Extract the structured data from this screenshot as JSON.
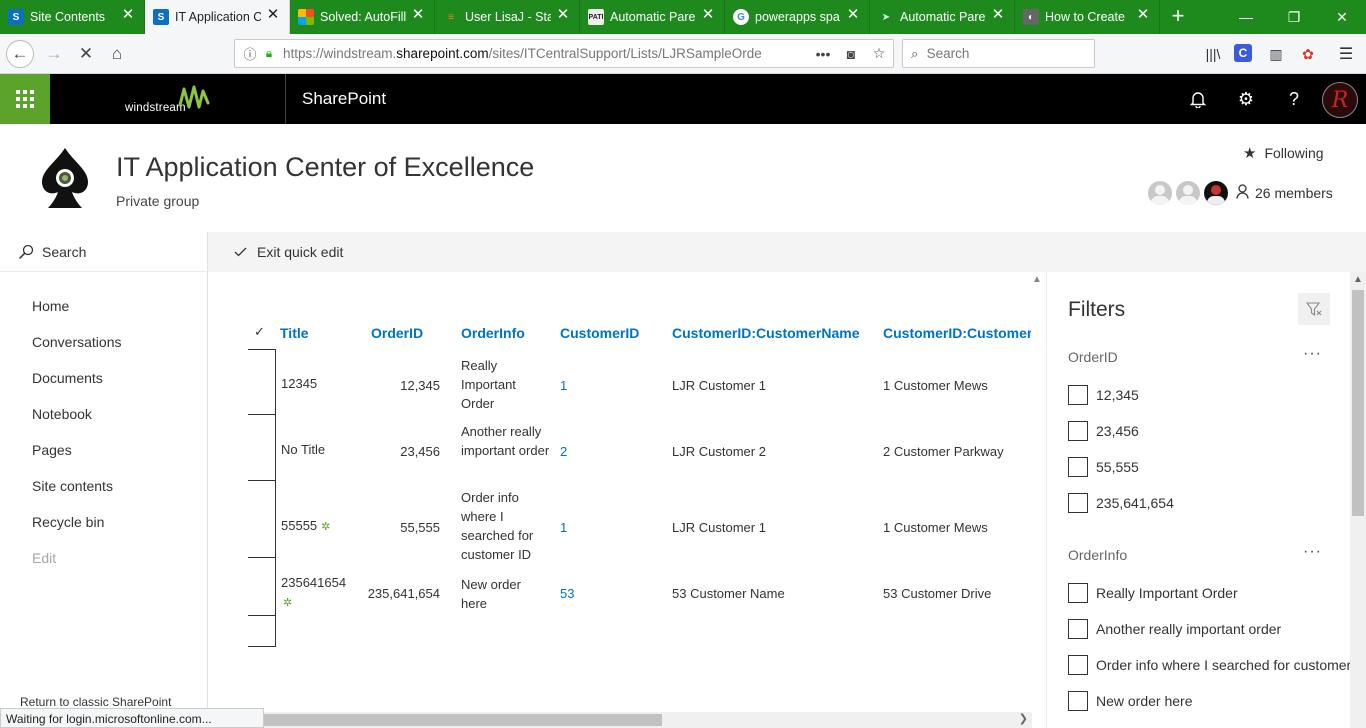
{
  "browser": {
    "tabs": [
      {
        "title": "Site Contents",
        "fav": "S",
        "favbg": "#0b6fc4",
        "active": false
      },
      {
        "title": "IT Application C",
        "fav": "S",
        "favbg": "#0b6fc4",
        "active": true
      },
      {
        "title": "Solved: AutoFill",
        "fav": "■",
        "favbg": "#d83b01",
        "active": false
      },
      {
        "title": "User LisaJ - Stac",
        "fav": "≡",
        "favbg": "#f48024",
        "active": false
      },
      {
        "title": "Automatic Pare",
        "fav": "PATI",
        "favbg": "#222",
        "active": false
      },
      {
        "title": "powerapps spa",
        "fav": "G",
        "favbg": "#fff",
        "active": false
      },
      {
        "title": "Automatic Pare",
        "fav": "➤",
        "favbg": "#1e8a1e",
        "active": false
      },
      {
        "title": "How to Create",
        "fav": "◐",
        "favbg": "#555",
        "active": false
      }
    ],
    "url_prefix": "https://windstream.",
    "url_domain": "sharepoint.com",
    "url_path": "/sites/ITCentralSupport/Lists/LJRSampleOrde",
    "search_placeholder": "Search",
    "status": "Waiting for login.microsoftonline.com..."
  },
  "suite": {
    "company": "windstream",
    "app": "SharePoint",
    "user_initial": "R"
  },
  "site": {
    "title": "IT Application Center of Excellence",
    "subtitle": "Private group",
    "following": "Following",
    "members": "26 members"
  },
  "leftnav": {
    "search": "Search",
    "items": [
      "Home",
      "Conversations",
      "Documents",
      "Notebook",
      "Pages",
      "Site contents",
      "Recycle bin"
    ],
    "edit": "Edit",
    "classic": "Return to classic SharePoint"
  },
  "command": {
    "exit_quick_edit": "Exit quick edit"
  },
  "list": {
    "columns": [
      "Title",
      "OrderID",
      "OrderInfo",
      "CustomerID",
      "CustomerID:CustomerName",
      "CustomerID:CustomerA"
    ],
    "rows": [
      {
        "title": "12345",
        "is_new": false,
        "order_id": "12,345",
        "order_info": "Really Important Order",
        "customer_id": "1",
        "customer_name": "LJR Customer 1",
        "customer_address": "1 Customer Mews"
      },
      {
        "title": "No Title",
        "is_new": false,
        "order_id": "23,456",
        "order_info": "Another really important order",
        "customer_id": "2",
        "customer_name": "LJR Customer 2",
        "customer_address": "2 Customer Parkway"
      },
      {
        "title": "55555",
        "is_new": true,
        "order_id": "55,555",
        "order_info": "Order info where I searched for customer ID",
        "customer_id": "1",
        "customer_name": "LJR Customer 1",
        "customer_address": "1 Customer Mews"
      },
      {
        "title": "235641654",
        "is_new": true,
        "order_id": "235,641,654",
        "order_info": "New order here",
        "customer_id": "53",
        "customer_name": "53 Customer Name",
        "customer_address": "53 Customer Drive"
      }
    ]
  },
  "filters": {
    "title": "Filters",
    "orderid_label": "OrderID",
    "orderid_options": [
      "12,345",
      "23,456",
      "55,555",
      "235,641,654"
    ],
    "orderinfo_label": "OrderInfo",
    "orderinfo_options": [
      "Really Important Order",
      "Another really important order",
      "Order info where I searched for customer",
      "New order here"
    ]
  },
  "colors": {
    "tabstrip": "#1e8a1e",
    "waffle": "#5ba32b",
    "link": "#0072c6"
  }
}
